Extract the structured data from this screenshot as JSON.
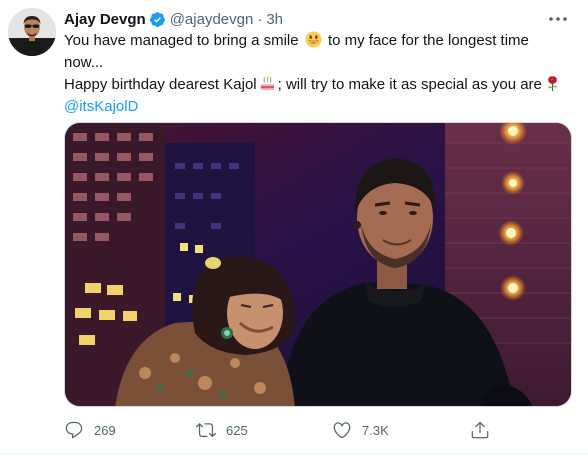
{
  "tweet": {
    "author": {
      "display_name": "Ajay Devgn",
      "handle": "@ajaydevgn",
      "separator": "·",
      "time": "3h",
      "verified": true
    },
    "text": {
      "line1_a": "You have managed to bring a smile",
      "line1_b": "to my face for the longest time",
      "line2": "now...",
      "line3_a": "Happy birthday dearest Kajol",
      "line3_b": "; will try to make it as special as you are",
      "mention": "@itsKajolD"
    },
    "emojis": [
      "smiling-face-emoji",
      "birthday-cake-emoji",
      "rose-emoji"
    ],
    "actions": {
      "replies": "269",
      "retweets": "625",
      "likes": "7.3K"
    }
  },
  "colors": {
    "accent": "#1d9bf0",
    "text": "#0f1419",
    "secondary_text": "#536471"
  }
}
